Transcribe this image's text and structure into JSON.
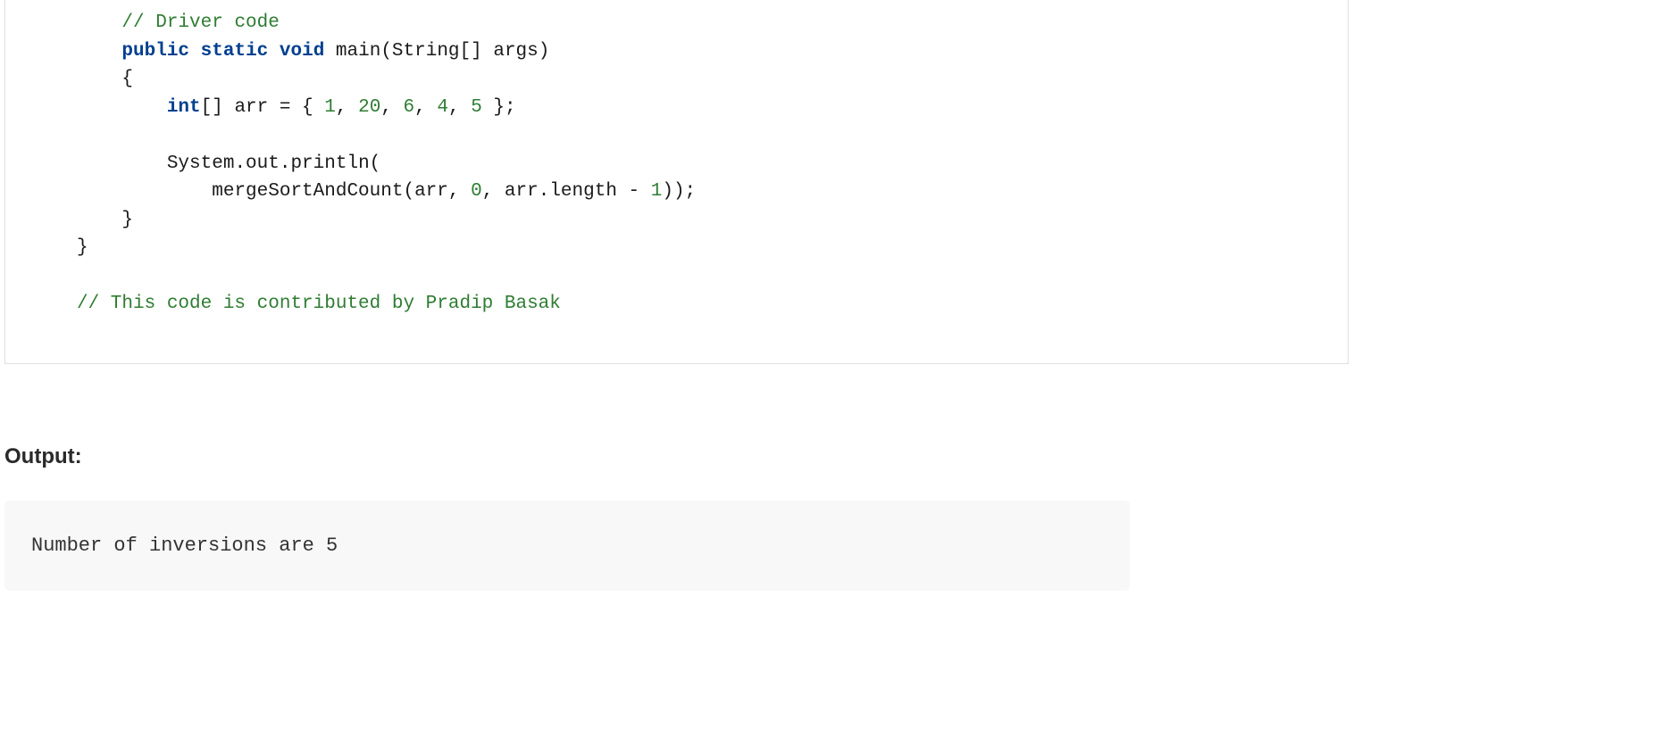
{
  "code": {
    "indent1": "    ",
    "indent2": "        ",
    "indent3": "            ",
    "comment_driver": "// Driver code",
    "kw_public": "public",
    "kw_static": "static",
    "kw_void": "void",
    "main_sig": " main(String[] args)",
    "brace_open": "{",
    "brace_close": "}",
    "kw_int": "int",
    "arr_decl": "[] arr = { ",
    "num1": "1",
    "num20": "20",
    "num6": "6",
    "num4": "4",
    "num5": "5",
    "arr_close": " };",
    "comma": ", ",
    "println": "System.out.println(",
    "merge_call_1": "mergeSortAndCount(arr, ",
    "num0": "0",
    "merge_call_2": ", arr.length - ",
    "numOne": "1",
    "merge_call_3": "));",
    "comment_contrib": "// This code is contributed by Pradip Basak"
  },
  "output": {
    "label": "Output:",
    "text": "Number of inversions are 5"
  }
}
